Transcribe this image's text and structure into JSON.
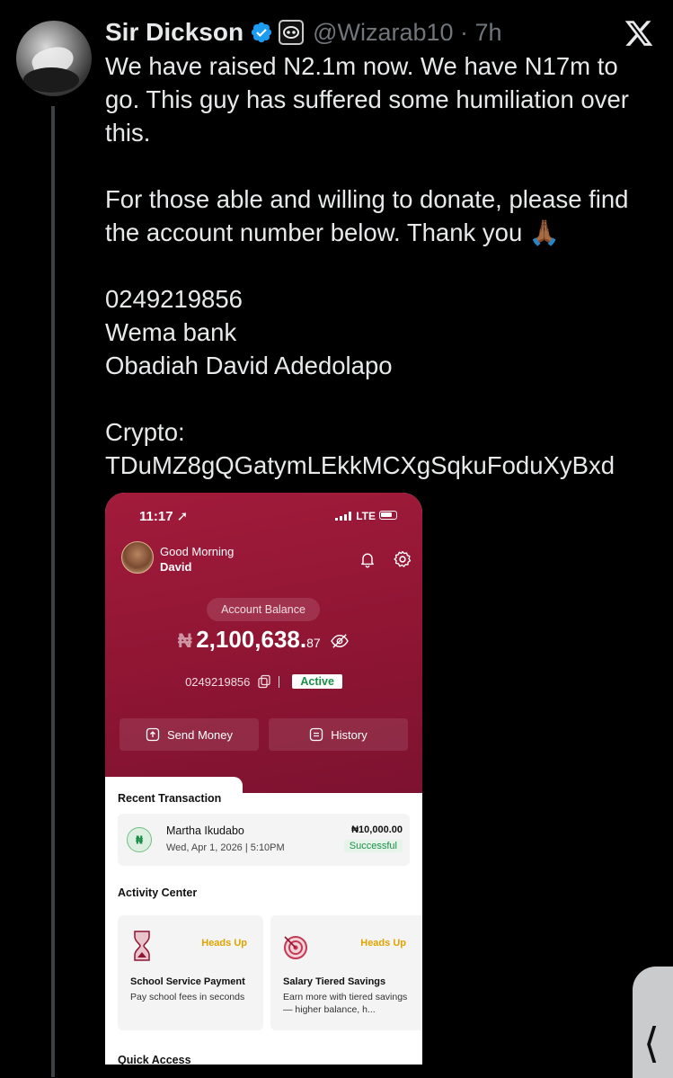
{
  "tweet": {
    "author_name": "Sir Dickson",
    "handle_time": "@Wizarab10 · 7h",
    "brand": "X",
    "lines": [
      "We have raised N2.1m now. We have N17m to",
      "go. This guy has suffered some humiliation over",
      "this.",
      "For those able and willing to donate, please find",
      "the account number below. Thank you 🙏🏾",
      "0249219856",
      "Wema bank",
      "Obadiah David Adedolapo",
      "Crypto:",
      "TDuMZ8gQGatymLEkkMCXgSqkuFoduXyBxd"
    ]
  },
  "phone": {
    "status": {
      "time": "11:17",
      "network": "LTE"
    },
    "greeting": "Good Morning",
    "user": "David",
    "balance_label": "Account Balance",
    "balance_currency": "₦",
    "balance_amount": "2,100,638.",
    "balance_decimal": "87",
    "account_number": "0249219856",
    "account_status": "Active",
    "send_money": "Send Money",
    "history": "History",
    "recent_title": "Recent Transaction",
    "transaction": {
      "name": "Martha Ikudabo",
      "date": "Wed, Apr 1, 2026 | 5:10PM",
      "amount": "₦10,000.00",
      "status": "Successful"
    },
    "activity_title": "Activity Center",
    "cards": [
      {
        "badge": "Heads Up",
        "title": "School Service Payment",
        "desc": "Pay school fees in seconds"
      },
      {
        "badge": "Heads Up",
        "title": "Salary Tiered Savings",
        "desc": "Earn more with tiered savings — higher balance, h..."
      }
    ],
    "quick_title": "Quick Access"
  },
  "colors": {
    "background": "#000000",
    "text": "#e7e9ea",
    "muted": "#71767b",
    "verified": "#1d9bf0",
    "phone_accent": "#8e1533"
  }
}
